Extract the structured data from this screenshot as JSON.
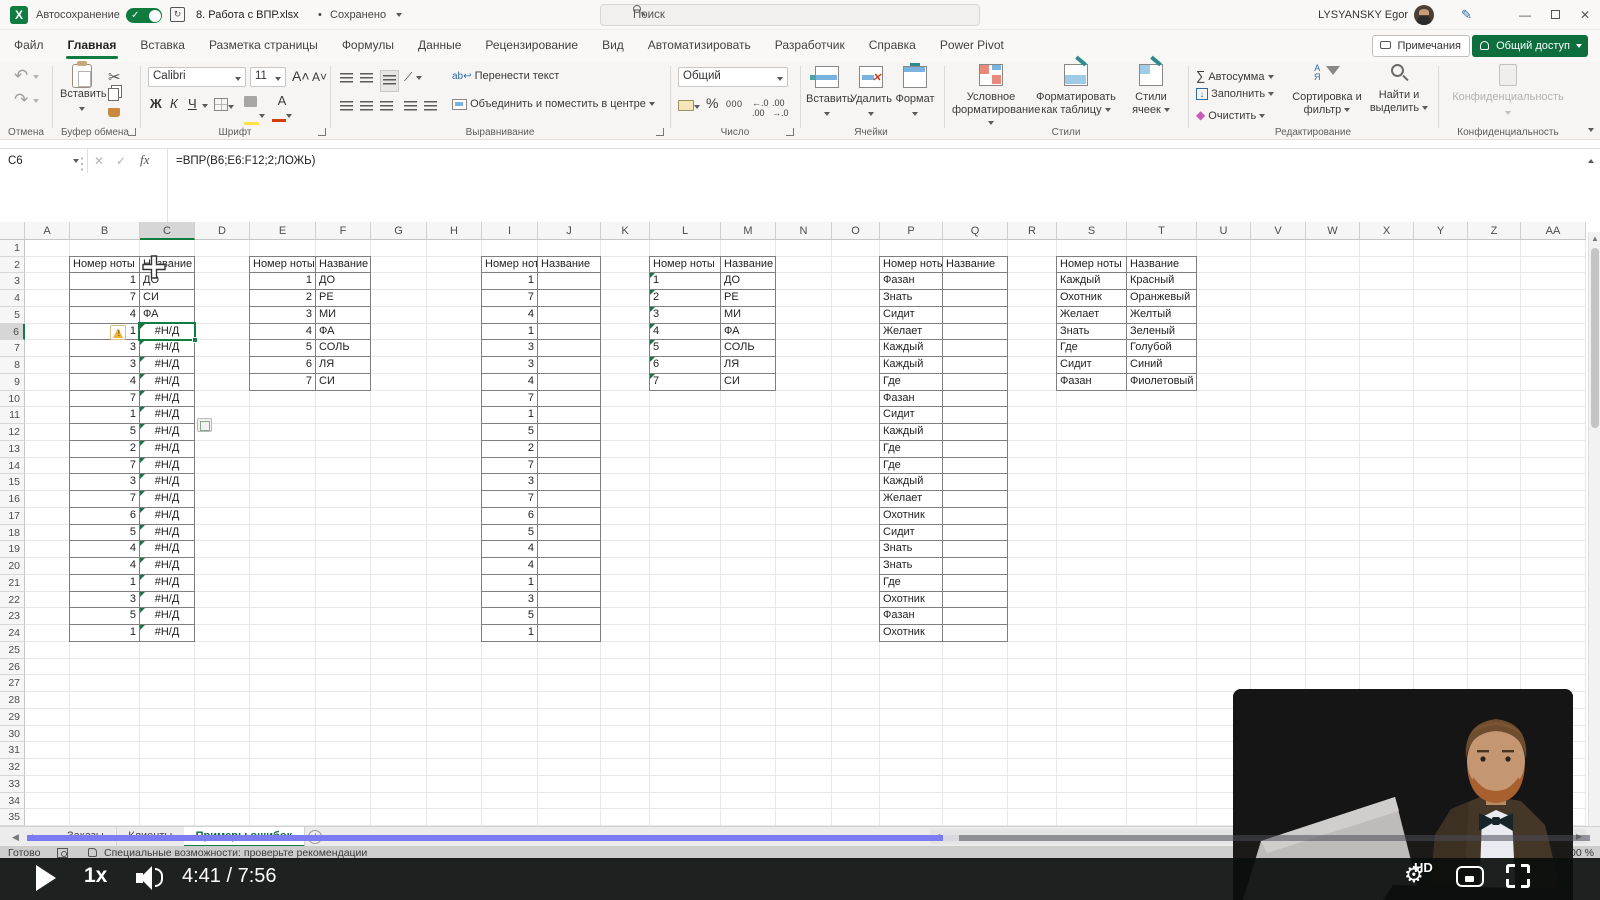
{
  "window": {
    "app": "X",
    "autosave_label": "Автосохранение",
    "filename": "8. Работа с ВПР.xlsx",
    "separator": "•",
    "saved_status": "Сохранено",
    "search_placeholder": "Поиск",
    "user": "LYSYANSKY Egor",
    "minimize": "—",
    "close": "✕"
  },
  "menu": {
    "items": [
      "Файл",
      "Главная",
      "Вставка",
      "Разметка страницы",
      "Формулы",
      "Данные",
      "Рецензирование",
      "Вид",
      "Автоматизировать",
      "Разработчик",
      "Справка",
      "Power Pivot"
    ],
    "active": "Главная",
    "comments": "Примечания",
    "share": "Общий доступ"
  },
  "ribbon": {
    "undo_group": "Отмена",
    "paste": "Вставить",
    "clipboard_group": "Буфер обмена",
    "font_name": "Calibri",
    "font_size": "11",
    "bold": "Ж",
    "italic": "К",
    "underline": "Ч",
    "font_group": "Шрифт",
    "wrap_text": "Перенести текст",
    "merge_center": "Объединить и поместить в центре",
    "align_group": "Выравнивание",
    "number_format": "Общий",
    "percent": "%",
    "thousands": "000",
    "number_group": "Число",
    "insert_cells": "Вставить",
    "delete_cells": "Удалить",
    "format_cells": "Формат",
    "cells_group": "Ячейки",
    "conditional": "Условное форматирование",
    "format_table": "Форматировать как таблицу",
    "cell_styles": "Стили ячеек",
    "styles_group": "Стили",
    "autosum": "Автосумма",
    "fill": "Заполнить",
    "clear": "Очистить",
    "sort_filter": "Сортировка и фильтр",
    "find_select": "Найти и выделить",
    "edit_group": "Редактирование",
    "privacy": "Конфиденциальность",
    "privacy_group": "Конфиденциальность"
  },
  "formula_bar": {
    "name_box": "C6",
    "fx": "fx",
    "formula": "=ВПР(B6;E6:F12;2;ЛОЖЬ)"
  },
  "spreadsheet": {
    "columns": [
      "A",
      "B",
      "C",
      "D",
      "E",
      "F",
      "G",
      "H",
      "I",
      "J",
      "K",
      "L",
      "M",
      "N",
      "O",
      "P",
      "Q",
      "R",
      "S",
      "T",
      "U",
      "V",
      "W",
      "X",
      "Y",
      "Z",
      "AA"
    ],
    "row_count": 35,
    "selection": {
      "col": "C",
      "row": 6
    },
    "error_value": "#Н/Д",
    "tables": [
      {
        "col": "B",
        "numbers_left": false,
        "header": [
          "Номер ноты",
          "Название"
        ],
        "rows": [
          [
            "1",
            "ДО"
          ],
          [
            "7",
            "СИ"
          ],
          [
            "4",
            "ФА"
          ],
          [
            "1",
            "#Н/Д"
          ],
          [
            "3",
            "#Н/Д"
          ],
          [
            "3",
            "#Н/Д"
          ],
          [
            "4",
            "#Н/Д"
          ],
          [
            "7",
            "#Н/Д"
          ],
          [
            "1",
            "#Н/Д"
          ],
          [
            "5",
            "#Н/Д"
          ],
          [
            "2",
            "#Н/Д"
          ],
          [
            "7",
            "#Н/Д"
          ],
          [
            "3",
            "#Н/Д"
          ],
          [
            "7",
            "#Н/Д"
          ],
          [
            "6",
            "#Н/Д"
          ],
          [
            "5",
            "#Н/Д"
          ],
          [
            "4",
            "#Н/Д"
          ],
          [
            "4",
            "#Н/Д"
          ],
          [
            "1",
            "#Н/Д"
          ],
          [
            "3",
            "#Н/Д"
          ],
          [
            "5",
            "#Н/Д"
          ],
          [
            "1",
            "#Н/Д"
          ]
        ]
      },
      {
        "col": "E",
        "numbers_left": false,
        "header": [
          "Номер ноты",
          "Название"
        ],
        "rows": [
          [
            "1",
            "ДО"
          ],
          [
            "2",
            "РЕ"
          ],
          [
            "3",
            "МИ"
          ],
          [
            "4",
            "ФА"
          ],
          [
            "5",
            "СОЛЬ"
          ],
          [
            "6",
            "ЛЯ"
          ],
          [
            "7",
            "СИ"
          ]
        ]
      },
      {
        "col": "I",
        "numbers_left": false,
        "header": [
          "Номер ноты",
          "Название"
        ],
        "rows": [
          [
            "1",
            ""
          ],
          [
            "7",
            ""
          ],
          [
            "4",
            ""
          ],
          [
            "1",
            ""
          ],
          [
            "3",
            ""
          ],
          [
            "3",
            ""
          ],
          [
            "4",
            ""
          ],
          [
            "7",
            ""
          ],
          [
            "1",
            ""
          ],
          [
            "5",
            ""
          ],
          [
            "2",
            ""
          ],
          [
            "7",
            ""
          ],
          [
            "3",
            ""
          ],
          [
            "7",
            ""
          ],
          [
            "6",
            ""
          ],
          [
            "5",
            ""
          ],
          [
            "4",
            ""
          ],
          [
            "4",
            ""
          ],
          [
            "1",
            ""
          ],
          [
            "3",
            ""
          ],
          [
            "5",
            ""
          ],
          [
            "1",
            ""
          ]
        ]
      },
      {
        "col": "L",
        "numbers_left": true,
        "header": [
          "Номер ноты",
          "Название"
        ],
        "rows": [
          [
            "1",
            "ДО"
          ],
          [
            "2",
            "РЕ"
          ],
          [
            "3",
            "МИ"
          ],
          [
            "4",
            "ФА"
          ],
          [
            "5",
            "СОЛЬ"
          ],
          [
            "6",
            "ЛЯ"
          ],
          [
            "7",
            "СИ"
          ]
        ]
      },
      {
        "col": "P",
        "numbers_left": false,
        "header": [
          "Номер ноты",
          "Название"
        ],
        "rows": [
          [
            "Фазан",
            ""
          ],
          [
            "Знать",
            ""
          ],
          [
            "Сидит",
            ""
          ],
          [
            "Желает",
            ""
          ],
          [
            "Каждый",
            ""
          ],
          [
            "Каждый",
            ""
          ],
          [
            "Где",
            ""
          ],
          [
            "Фазан",
            ""
          ],
          [
            "Сидит",
            ""
          ],
          [
            "Каждый",
            ""
          ],
          [
            "Где",
            ""
          ],
          [
            "Где",
            ""
          ],
          [
            "Каждый",
            ""
          ],
          [
            "Желает",
            ""
          ],
          [
            "Охотник",
            ""
          ],
          [
            "Сидит",
            ""
          ],
          [
            "Знать",
            ""
          ],
          [
            "Знать",
            ""
          ],
          [
            "Где",
            ""
          ],
          [
            "Охотник",
            ""
          ],
          [
            "Фазан",
            ""
          ],
          [
            "Охотник",
            ""
          ]
        ]
      },
      {
        "col": "S",
        "numbers_left": false,
        "header": [
          "Номер ноты",
          "Название"
        ],
        "rows": [
          [
            "Каждый",
            "Красный"
          ],
          [
            "Охотник",
            "Оранжевый"
          ],
          [
            "Желает",
            "Желтый"
          ],
          [
            "Знать",
            "Зеленый"
          ],
          [
            "Где",
            "Голубой"
          ],
          [
            "Сидит",
            "Синий"
          ],
          [
            "Фазан",
            "Фиолетовый"
          ]
        ]
      }
    ]
  },
  "sheet_bar": {
    "tabs": [
      "Заказы",
      "Клиенты",
      "Примеры ошибок"
    ],
    "active": "Примеры ошибок",
    "new_sheet": "+"
  },
  "status_bar": {
    "ready": "Готово",
    "accessibility": "Специальные возможности: проверьте рекомендации",
    "zoom_level": "100 %"
  },
  "player": {
    "speed": "1x",
    "time": "4:41 / 7:56",
    "progress_fraction": 0.586,
    "accent_color": "#7b7bf2"
  },
  "colors": {
    "excel_green": "#107C41",
    "share_button": "#0e6e3d",
    "error_triangle": "#1E7145",
    "warning_yellow": "#f0b334"
  }
}
